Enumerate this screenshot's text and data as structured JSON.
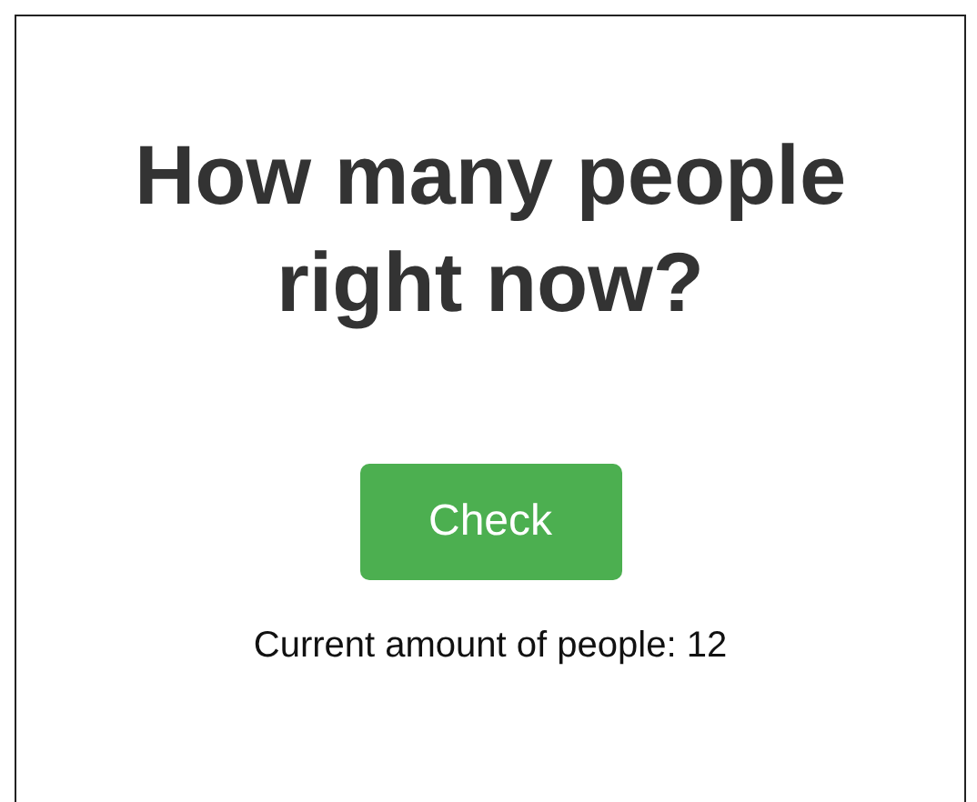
{
  "heading": "How many people right now?",
  "button": {
    "label": "Check"
  },
  "status": "Current amount of people: 12"
}
